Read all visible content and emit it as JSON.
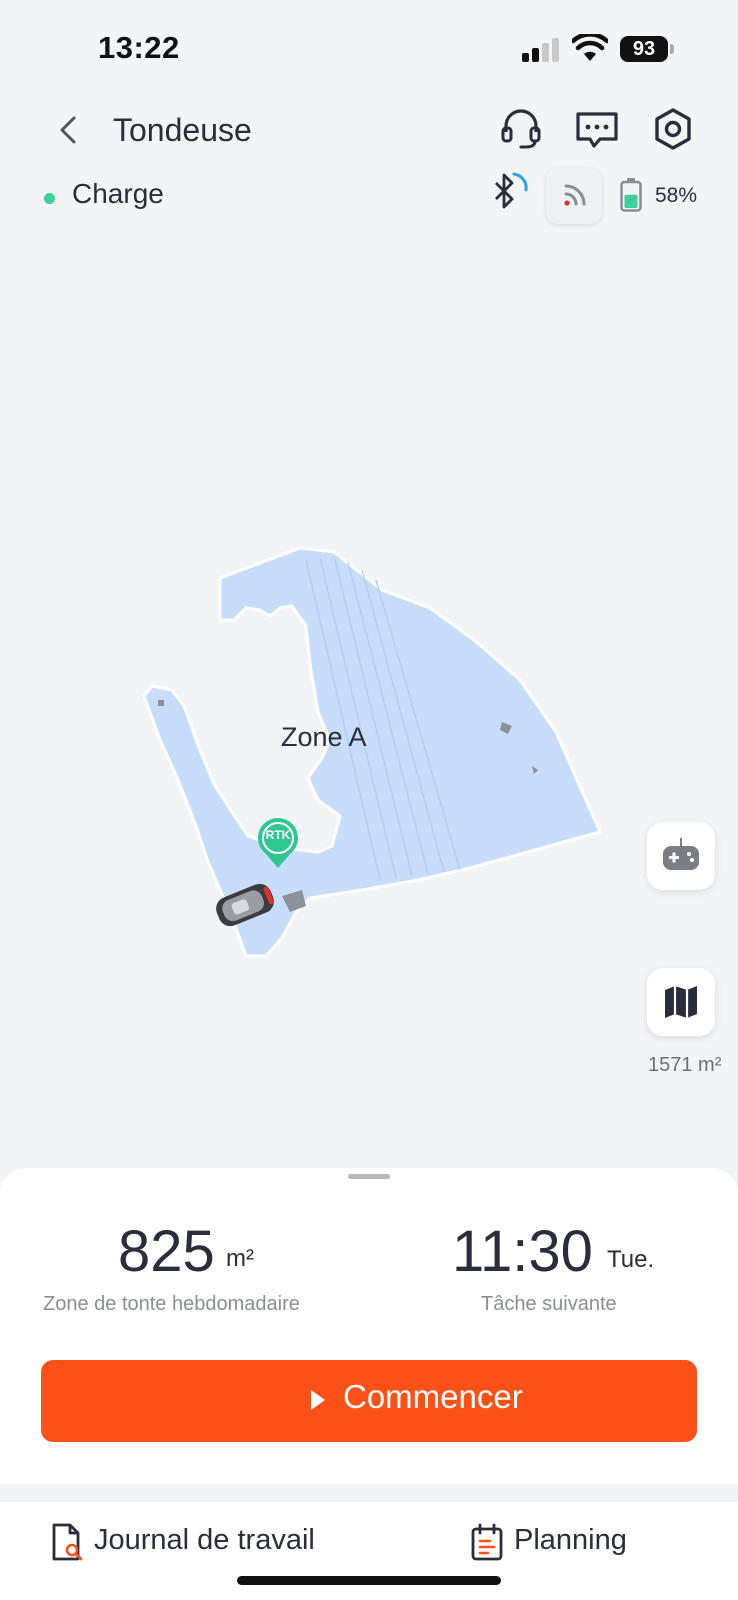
{
  "status_bar": {
    "time": "13:22",
    "battery": "93"
  },
  "header": {
    "title": "Tondeuse",
    "icons": [
      "headset-icon",
      "chat-icon",
      "settings-icon"
    ]
  },
  "device": {
    "status": "Charge",
    "status_color": "#3ecf9b",
    "battery_percent": "58%",
    "battery_level": 0.58
  },
  "map": {
    "zone_name": "Zone A",
    "rtk_label": "RTK",
    "total_area": "1571 m²",
    "zone_color": "#c7ddfb"
  },
  "stats": {
    "weekly_area_value": "825",
    "weekly_area_unit": "m²",
    "weekly_area_label": "Zone de tonte hebdomadaire",
    "next_task_time": "11:30",
    "next_task_day": "Tue.",
    "next_task_label": "Tâche suivante"
  },
  "actions": {
    "start_label": "Commencer",
    "accent": "#fd5117"
  },
  "bottom_nav": {
    "work_log": "Journal de travail",
    "planning": "Planning"
  }
}
